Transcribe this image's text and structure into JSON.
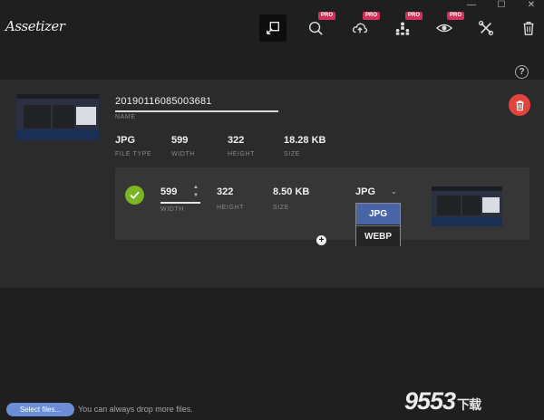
{
  "app": {
    "logo_text": "Assetizer"
  },
  "toolbar": {
    "pro_badge": "PRO",
    "tools": [
      {
        "icon": "resize-icon",
        "active": true,
        "pro": false
      },
      {
        "icon": "magnify-icon",
        "active": false,
        "pro": true
      },
      {
        "icon": "cloud-upload-icon",
        "active": false,
        "pro": true
      },
      {
        "icon": "user-group-icon",
        "active": false,
        "pro": true
      },
      {
        "icon": "eye-icon",
        "active": false,
        "pro": true
      },
      {
        "icon": "tools-icon",
        "active": false,
        "pro": false
      },
      {
        "icon": "trash-icon",
        "active": false,
        "pro": false
      }
    ]
  },
  "window": {
    "minimize": "—",
    "maximize": "☐",
    "close": "✕"
  },
  "help": {
    "label": "?"
  },
  "file": {
    "name": "20190116085003681",
    "name_label": "NAME",
    "file_type": "JPG",
    "file_type_label": "FILE TYPE",
    "width": "599",
    "width_label": "WIDTH",
    "height": "322",
    "height_label": "HEIGHT",
    "size": "18.28 KB",
    "size_label": "SIZE"
  },
  "output": {
    "width": "599",
    "width_label": "WIDTH",
    "height": "322",
    "height_label": "HEIGHT",
    "size": "8.50 KB",
    "size_label": "SIZE",
    "format": "JPG",
    "format_options": [
      "JPG",
      "WEBP"
    ]
  },
  "add_output": "+",
  "footer": {
    "select_files": "Select files...",
    "drop_hint": "You can always drop more files."
  },
  "watermark": {
    "number": "9553",
    "chinese": "下载"
  },
  "colors": {
    "pro_badge": "#d2315a",
    "delete": "#e2443d",
    "check": "#7ab623",
    "dropdown_selected": "#4a64a8",
    "select_button": "#6b8ed6"
  }
}
